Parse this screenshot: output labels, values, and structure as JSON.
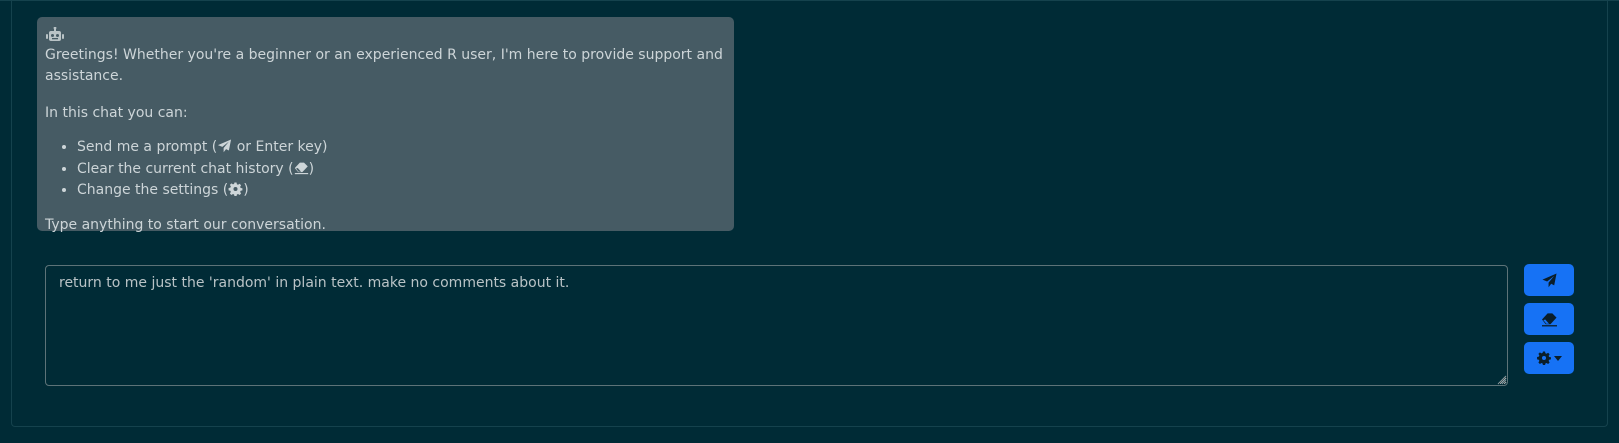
{
  "chat": {
    "greeting": "Greetings! Whether you're a beginner or an experienced R user, I'm here to provide support and assistance.",
    "intro": "In this chat you can:",
    "items": [
      {
        "pre": "Send me a prompt (",
        "post": " or Enter key)",
        "icon": "paper-plane-icon"
      },
      {
        "pre": "Clear the current chat history (",
        "post": ")",
        "icon": "eraser-icon"
      },
      {
        "pre": "Change the settings (",
        "post": ")",
        "icon": "gear-icon"
      }
    ],
    "outro": "Type anything to start our conversation."
  },
  "prompt": {
    "value": "return to me just the 'random' in plain text. make no comments about it."
  },
  "colors": {
    "background": "#002b36",
    "bubble": "#465b64",
    "accent": "#1672f5"
  },
  "icons": {
    "assistant_avatar": "robot-icon",
    "send_button": "paper-plane-icon",
    "clear_button": "eraser-icon",
    "settings_button": "gear-icon",
    "settings_caret": "caret-down-icon"
  }
}
